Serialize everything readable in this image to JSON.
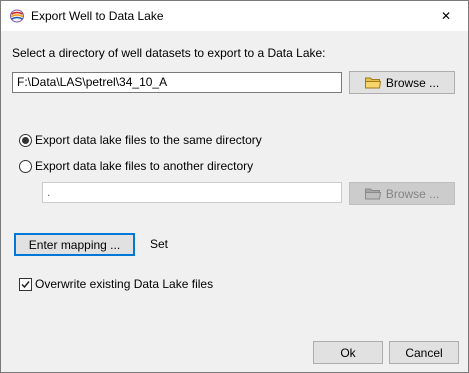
{
  "window": {
    "title": "Export Well to Data Lake",
    "close_glyph": "✕"
  },
  "source": {
    "prompt": "Select a directory of well datasets to export to a Data Lake:",
    "path_value": "F:\\Data\\LAS\\petrel\\34_10_A",
    "browse_label": "Browse ..."
  },
  "destination": {
    "option_same_label": "Export data lake files to the same directory",
    "option_other_label": "Export data lake files to another directory",
    "selected": "same",
    "other_path_value": ".",
    "browse_label": "Browse ..."
  },
  "mapping": {
    "button_label": "Enter mapping ...",
    "status": "Set"
  },
  "overwrite": {
    "label": "Overwrite existing Data Lake files",
    "checked": true
  },
  "footer": {
    "ok_label": "Ok",
    "cancel_label": "Cancel"
  },
  "colors": {
    "focus_accent": "#0078d7",
    "folder_yellow": "#e8c04c"
  },
  "icons": {
    "app": "app-logo-icon",
    "close": "close-icon",
    "browse": "folder-icon",
    "check": "checkmark-icon"
  }
}
